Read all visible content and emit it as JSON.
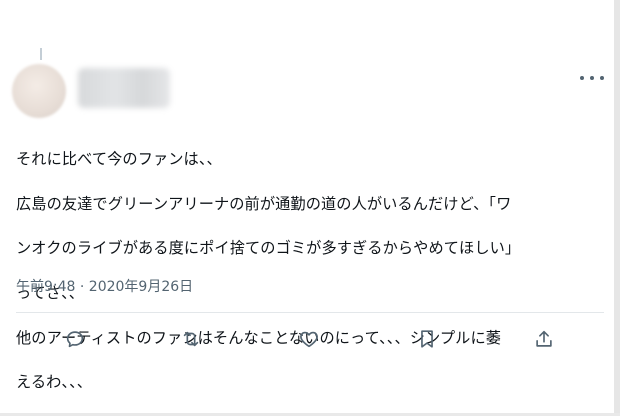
{
  "tweet": {
    "text_lines": [
      "それに比べて今のファンは、、",
      "広島の友達でグリーンアリーナの前が通勤の道の人がいるんだけど、「ワ",
      "ンオクのライブがある度にポイ捨てのゴミが多すぎるからやめてほしい」",
      "ってさ、、",
      "他のアーティストのファンはそんなことないのにって、、、シンプルに萎",
      "えるわ、、、"
    ],
    "timestamp": "午前9:48 · 2020年9月26日"
  },
  "icons": {
    "more": "more-horizontal-icon",
    "reply": "reply-icon",
    "retweet": "retweet-icon",
    "like": "heart-icon",
    "bookmark": "bookmark-icon",
    "share": "share-icon"
  },
  "colors": {
    "text": "#0f1419",
    "secondary": "#536471",
    "divider": "#e3e7ea"
  }
}
